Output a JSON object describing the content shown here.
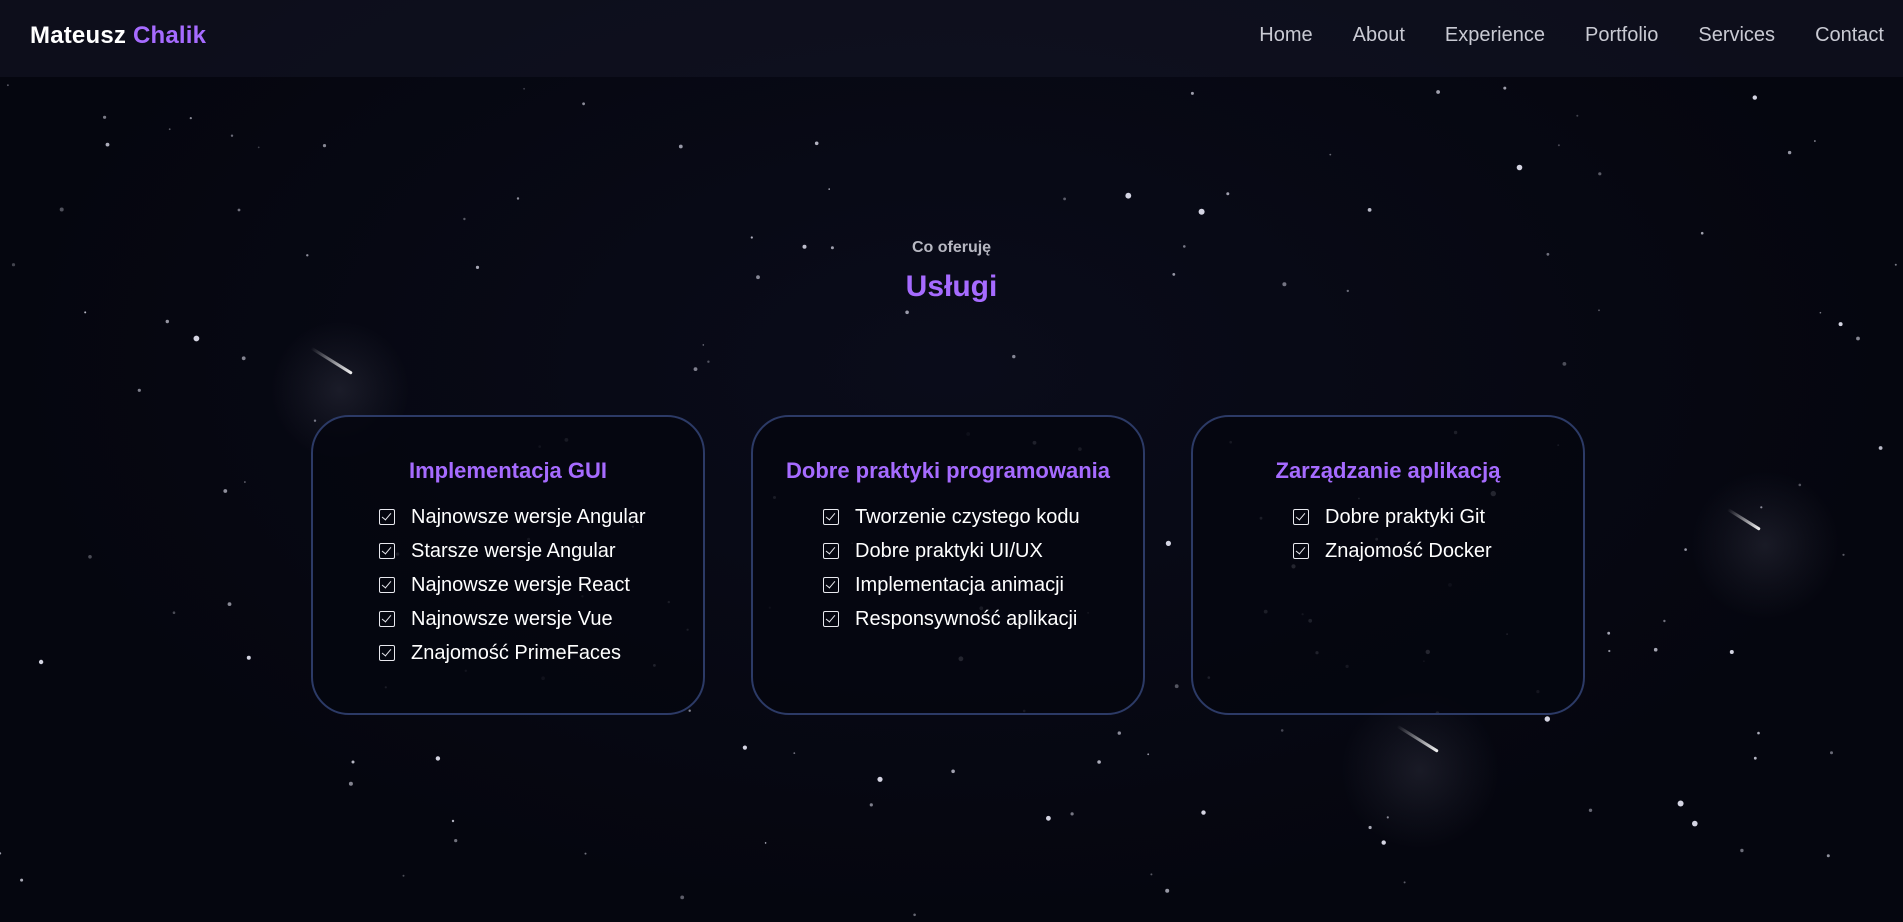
{
  "header": {
    "brand_first": "Mateusz",
    "brand_last": "Chalik",
    "nav": [
      "Home",
      "About",
      "Experience",
      "Portfolio",
      "Services",
      "Contact"
    ]
  },
  "section": {
    "eyebrow": "Co oferuję",
    "title": "Usługi"
  },
  "cards": [
    {
      "title": "Implementacja GUI",
      "items": [
        "Najnowsze wersje Angular",
        "Starsze wersje Angular",
        "Najnowsze wersje React",
        "Najnowsze wersje Vue",
        "Znajomość PrimeFaces"
      ]
    },
    {
      "title": "Dobre praktyki programowania",
      "items": [
        "Tworzenie czystego kodu",
        "Dobre praktyki UI/UX",
        "Implementacja animacji",
        "Responsywność aplikacji"
      ]
    },
    {
      "title": "Zarządzanie aplikacją",
      "items": [
        "Dobre praktyki Git",
        "Znajomość Docker"
      ]
    }
  ],
  "colors": {
    "background": "#05060f",
    "accent": "#a66bff",
    "card_border": "#2c3a66",
    "nav_text": "#c9cad3"
  },
  "icons": {
    "list_check": "checkbox-checked-icon"
  }
}
